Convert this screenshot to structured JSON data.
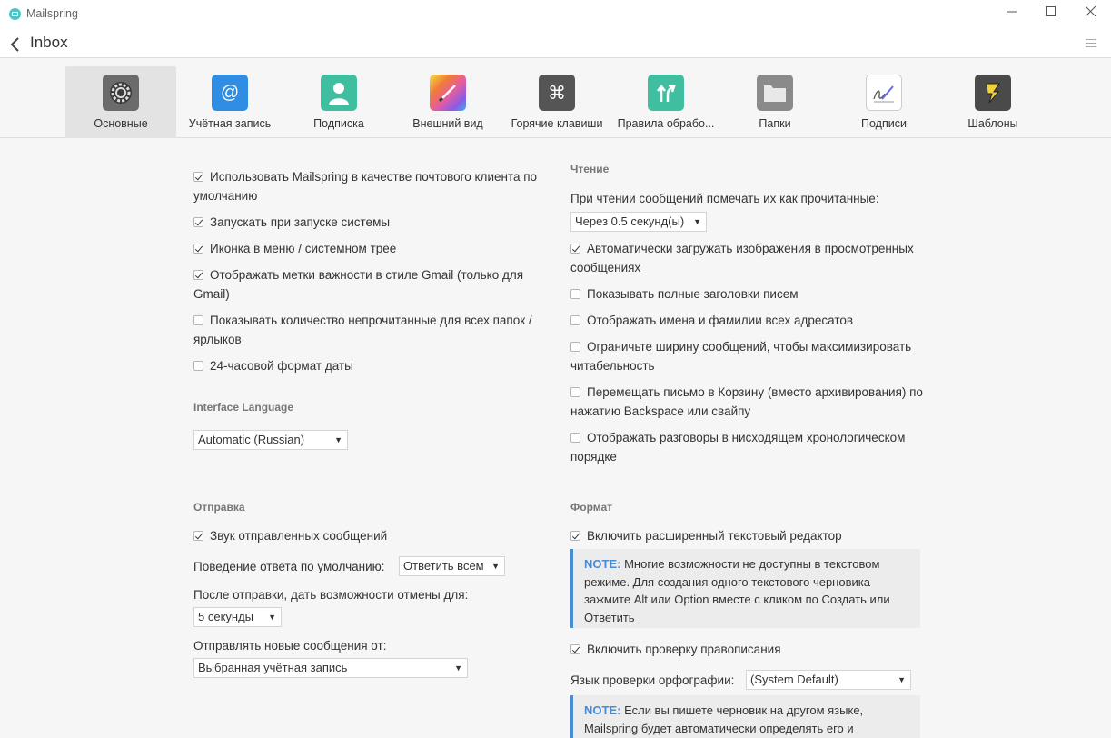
{
  "window": {
    "app_title": "Mailspring",
    "minimize_glyph": "—",
    "maximize_glyph": "☐",
    "close_glyph": "✕"
  },
  "nav": {
    "title": "Inbox"
  },
  "tabs": [
    {
      "label": "Основные",
      "icon": "gear-icon",
      "color": "#6b6b6b",
      "active": true
    },
    {
      "label": "Учётная запись",
      "icon": "at-sign-icon",
      "color": "#2f8de4",
      "active": false
    },
    {
      "label": "Подписка",
      "icon": "person-icon",
      "color": "#3fbfa0",
      "active": false
    },
    {
      "label": "Внешний вид",
      "icon": "palette-icon",
      "color": "#e55ca0",
      "active": false
    },
    {
      "label": "Горячие клавиши",
      "icon": "command-key-icon",
      "color": "#555555",
      "active": false
    },
    {
      "label": "Правила обрабо...",
      "icon": "routing-arrows-icon",
      "color": "#3fbfa0",
      "active": false
    },
    {
      "label": "Папки",
      "icon": "folder-icon",
      "color": "#8a8a8a",
      "active": false
    },
    {
      "label": "Подписи",
      "icon": "signature-pen-icon",
      "color": "#ffffff",
      "active": false
    },
    {
      "label": "Шаблоны",
      "icon": "template-bolt-icon",
      "color": "#4a4a4a",
      "active": false
    }
  ],
  "general": {
    "options": [
      {
        "label": "Использовать Mailspring в качестве почтового клиента по умолчанию",
        "checked": true
      },
      {
        "label": "Запускать при запуске системы",
        "checked": true
      },
      {
        "label": "Иконка в меню / системном трее",
        "checked": true
      },
      {
        "label": "Отображать метки важности в стиле Gmail (только для Gmail)",
        "checked": true
      },
      {
        "label": "Показывать количество непрочитанные для всех папок / ярлыков",
        "checked": false
      },
      {
        "label": "24-часовой формат даты",
        "checked": false
      }
    ],
    "language_title": "Interface Language",
    "language_value": "Automatic (Russian)"
  },
  "reading": {
    "title": "Чтение",
    "mark_read_label": "При чтении сообщений помечать их как прочитанные:",
    "mark_read_value": "Через 0.5 секунд(ы)",
    "options": [
      {
        "label": "Автоматически загружать изображения в просмотренных сообщениях",
        "checked": true
      },
      {
        "label": "Показывать полные заголовки писем",
        "checked": false
      },
      {
        "label": "Отображать имена и фамилии всех адресатов",
        "checked": false
      },
      {
        "label": "Ограничьте ширину сообщений, чтобы максимизировать читабельность",
        "checked": false
      },
      {
        "label": "Перемещать письмо в Корзину (вместо архивирования) по нажатию Backspace или свайпу",
        "checked": false
      },
      {
        "label": "Отображать разговоры в нисходящем хронологическом порядке",
        "checked": false
      }
    ]
  },
  "sending": {
    "title": "Отправка",
    "sound_label": "Звук отправленных сообщений",
    "sound_checked": true,
    "reply_label": "Поведение ответа по умолчанию:",
    "reply_value": "Ответить всем",
    "undo_label": "После отправки, дать возможности отмены для:",
    "undo_value": "5 секунды",
    "from_label": "Отправлять новые сообщения от:",
    "from_value": "Выбранная учётная запись"
  },
  "format": {
    "title": "Формат",
    "rich_label": "Включить расширенный текстовый редактор",
    "rich_checked": true,
    "note1_prefix": "NOTE:",
    "note1_text": "Многие возможности не доступны в текстовом режиме. Для создания одного текстового черновика зажмите Alt или Option вместе с кликом по Создать или Ответить",
    "spell_label": "Включить проверку правописания",
    "spell_checked": true,
    "spell_lang_label": "Язык проверки орфографии:",
    "spell_lang_value": "(System Default)",
    "note2_prefix": "NOTE:",
    "note2_text": "Если вы пишете черновик на другом языке, Mailspring будет автоматически определять его и"
  }
}
